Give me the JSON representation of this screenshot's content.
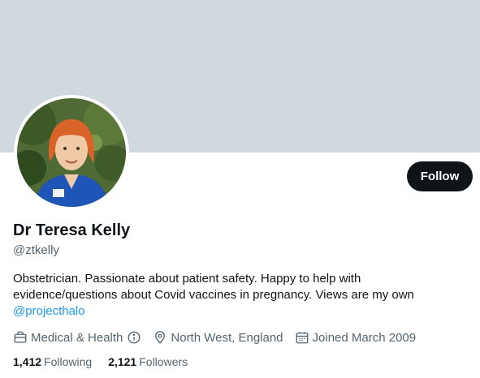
{
  "profile": {
    "name": "Dr Teresa Kelly",
    "handle": "@ztkelly",
    "bio_lines": [
      "Obstetrician. Passionate about patient safety. Happy to help with",
      "evidence/questions about Covid vaccines in pregnancy. Views are my own"
    ],
    "bio_mention": "@projecthalo",
    "category": "Medical & Health",
    "location": "North West, England",
    "joined": "Joined March 2009"
  },
  "actions": {
    "follow_label": "Follow"
  },
  "stats": {
    "following_count": "1,412",
    "following_label": "Following",
    "followers_count": "2,121",
    "followers_label": "Followers"
  },
  "icons": {
    "category": "briefcase-icon",
    "info": "info-circle-icon",
    "location": "map-pin-icon",
    "joined": "calendar-icon"
  },
  "colors": {
    "banner": "#cfd9de",
    "primary_text": "#0f1419",
    "secondary_text": "#536471",
    "link": "#1d9bf0",
    "follow_button": "#0f1419"
  }
}
